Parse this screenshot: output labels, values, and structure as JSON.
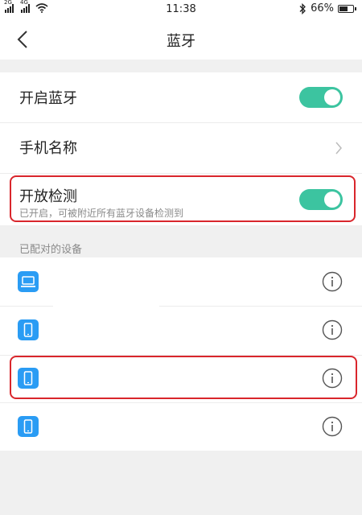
{
  "status_bar": {
    "net_label_1": "2G",
    "net_label_2": "4G",
    "time": "11:38",
    "battery_text": "66%",
    "battery_level": 0.66
  },
  "header": {
    "title": "蓝牙"
  },
  "settings": {
    "bluetooth_label": "开启蓝牙",
    "bluetooth_on": true,
    "phone_name_label": "手机名称",
    "discoverable_label": "开放检测",
    "discoverable_sub": "已开启，可被附近所有蓝牙设备检测到",
    "discoverable_on": true
  },
  "paired": {
    "section_label": "已配对的设备",
    "devices": [
      {
        "type": "laptop-icon"
      },
      {
        "type": "phone-icon"
      },
      {
        "type": "phone-icon"
      },
      {
        "type": "phone-icon"
      }
    ]
  },
  "colors": {
    "toggle_on": "#3cc4a0",
    "device_icon": "#2a9cf4",
    "highlight_border": "#d9262c"
  }
}
